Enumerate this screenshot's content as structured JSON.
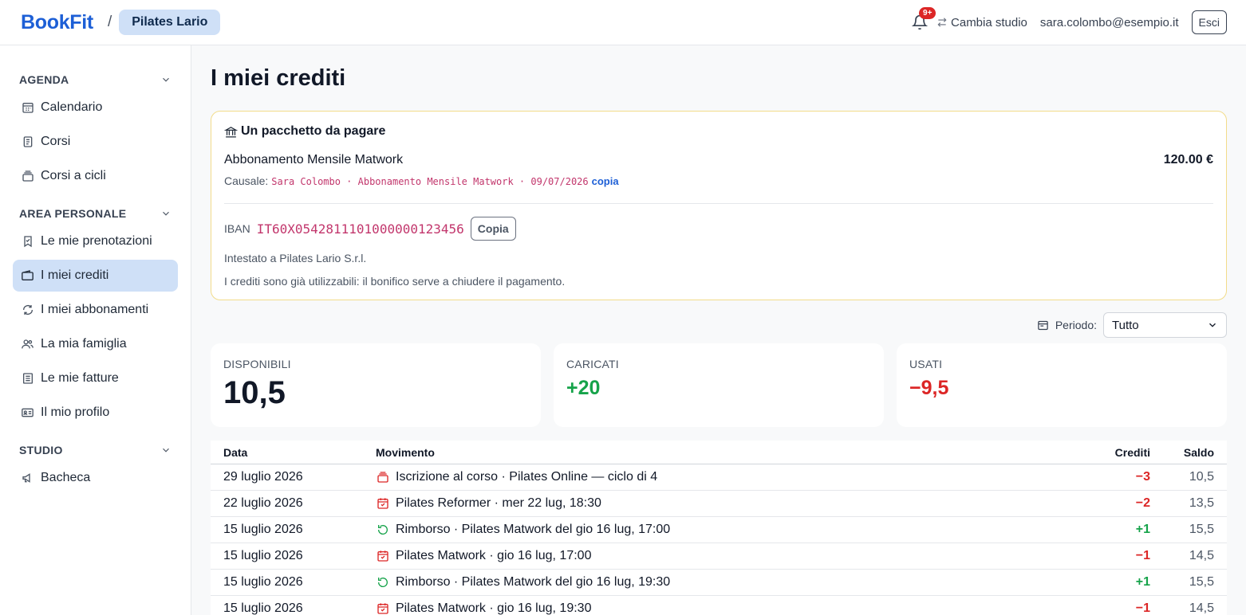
{
  "header": {
    "logo": "BookFit",
    "separator": "/",
    "studio": "Pilates Lario",
    "notification_badge": "9+",
    "switch_studio": "Cambia studio",
    "user_email": "sara.colombo@esempio.it",
    "logout": "Esci"
  },
  "sidebar": {
    "sections": [
      {
        "title": "AGENDA",
        "items": [
          {
            "label": "Calendario",
            "icon": "calendar-grid-icon"
          },
          {
            "label": "Corsi",
            "icon": "clipboard-list-icon"
          },
          {
            "label": "Corsi a cicli",
            "icon": "stack-icon"
          }
        ]
      },
      {
        "title": "AREA PERSONALE",
        "items": [
          {
            "label": "Le mie prenotazioni",
            "icon": "bookmark-icon"
          },
          {
            "label": "I miei crediti",
            "icon": "wallet-icon",
            "active": true
          },
          {
            "label": "I miei abbonamenti",
            "icon": "refresh-icon"
          },
          {
            "label": "La mia famiglia",
            "icon": "users-icon"
          },
          {
            "label": "Le mie fatture",
            "icon": "receipt-icon"
          },
          {
            "label": "Il mio profilo",
            "icon": "id-card-icon"
          }
        ]
      },
      {
        "title": "STUDIO",
        "items": [
          {
            "label": "Bacheca",
            "icon": "megaphone-icon"
          }
        ]
      }
    ]
  },
  "main": {
    "title": "I miei crediti",
    "payment": {
      "title": "Un pacchetto da pagare",
      "package": "Abbonamento Mensile Matwork",
      "amount": "120.00 €",
      "causale_label": "Causale:",
      "causale_value": "Sara Colombo · Abbonamento Mensile Matwork · 09/07/2026",
      "causale_copy": "copia",
      "iban_label": "IBAN",
      "iban": "IT60X0542811101000000123456",
      "iban_copy": "Copia",
      "holder": "Intestato a Pilates Lario S.r.l.",
      "note": "I crediti sono già utilizzabili: il bonifico serve a chiudere il pagamento."
    },
    "period": {
      "label": "Periodo:",
      "value": "Tutto"
    },
    "stats": {
      "available": {
        "label": "DISPONIBILI",
        "value": "10,5"
      },
      "loaded": {
        "label": "CARICATI",
        "value": "+20"
      },
      "used": {
        "label": "USATI",
        "value": "−9,5"
      }
    },
    "table": {
      "headers": {
        "date": "Data",
        "movement": "Movimento",
        "credits": "Crediti",
        "balance": "Saldo"
      },
      "rows": [
        {
          "date": "29 luglio 2026",
          "icon": "stack-icon",
          "movement": "Iscrizione al corso · Pilates Online — ciclo di 4",
          "credits": "−3",
          "balance": "10,5",
          "type": "debit"
        },
        {
          "date": "22 luglio 2026",
          "icon": "calendar-check-icon",
          "movement": "Pilates Reformer · mer 22 lug, 18:30",
          "credits": "−2",
          "balance": "13,5",
          "type": "debit"
        },
        {
          "date": "15 luglio 2026",
          "icon": "refund-icon",
          "movement": "Rimborso · Pilates Matwork del gio 16 lug, 17:00",
          "credits": "+1",
          "balance": "15,5",
          "type": "credit"
        },
        {
          "date": "15 luglio 2026",
          "icon": "calendar-check-icon",
          "movement": "Pilates Matwork · gio 16 lug, 17:00",
          "credits": "−1",
          "balance": "14,5",
          "type": "debit"
        },
        {
          "date": "15 luglio 2026",
          "icon": "refund-icon",
          "movement": "Rimborso · Pilates Matwork del gio 16 lug, 19:30",
          "credits": "+1",
          "balance": "15,5",
          "type": "credit"
        },
        {
          "date": "15 luglio 2026",
          "icon": "calendar-check-icon",
          "movement": "Pilates Matwork · gio 16 lug, 19:30",
          "credits": "−1",
          "balance": "14,5",
          "type": "debit"
        }
      ]
    }
  },
  "colors": {
    "accent": "#1d5fd6",
    "active_bg": "#cfe0f7",
    "credit": "#16a34a",
    "debit": "#dc2626",
    "iban": "#c2366c"
  }
}
